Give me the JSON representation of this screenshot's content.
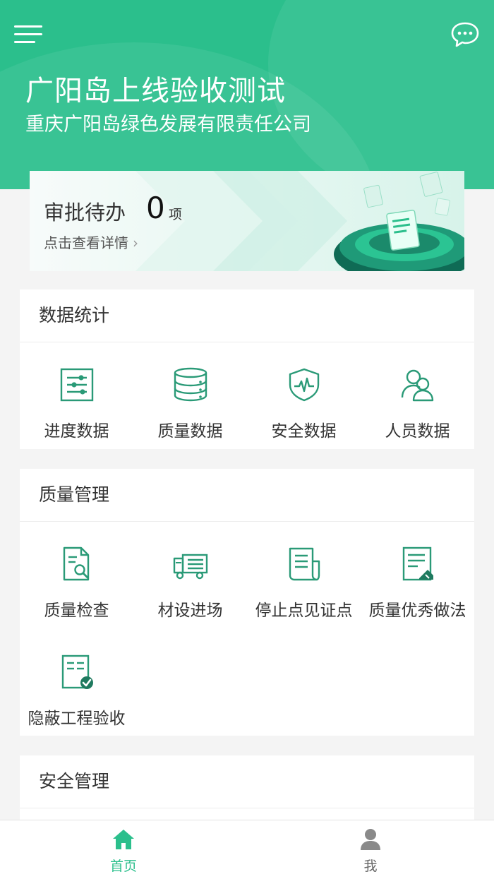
{
  "header": {
    "title": "广阳岛上线验收测试",
    "subtitle": "重庆广阳岛绿色发展有限责任公司",
    "menu_icon": "hamburger-menu-icon",
    "message_icon": "chat-bubble-icon",
    "color": "#2bbf8c"
  },
  "approval": {
    "label": "审批待办",
    "count": "0",
    "unit": "项",
    "link": "点击查看详情",
    "link_arrow": "›"
  },
  "sections": {
    "data_stats": {
      "title": "数据统计",
      "items": [
        {
          "label": "进度数据",
          "icon": "sliders-icon"
        },
        {
          "label": "质量数据",
          "icon": "database-icon"
        },
        {
          "label": "安全数据",
          "icon": "shield-pulse-icon"
        },
        {
          "label": "人员数据",
          "icon": "people-icon"
        }
      ]
    },
    "quality": {
      "title": "质量管理",
      "items": [
        {
          "label": "质量检查",
          "icon": "document-search-icon"
        },
        {
          "label": "材设进场",
          "icon": "truck-icon"
        },
        {
          "label": "停止点见证点",
          "icon": "scroll-document-icon"
        },
        {
          "label": "质量优秀做法",
          "icon": "document-edit-icon"
        },
        {
          "label": "隐蔽工程验收",
          "icon": "document-check-icon"
        }
      ]
    },
    "safety": {
      "title": "安全管理"
    }
  },
  "tabbar": {
    "home": {
      "label": "首页",
      "icon": "home-icon",
      "active": true
    },
    "me": {
      "label": "我",
      "icon": "person-icon",
      "active": false
    },
    "active_color": "#2bbf8c",
    "inactive_color": "#888888"
  }
}
